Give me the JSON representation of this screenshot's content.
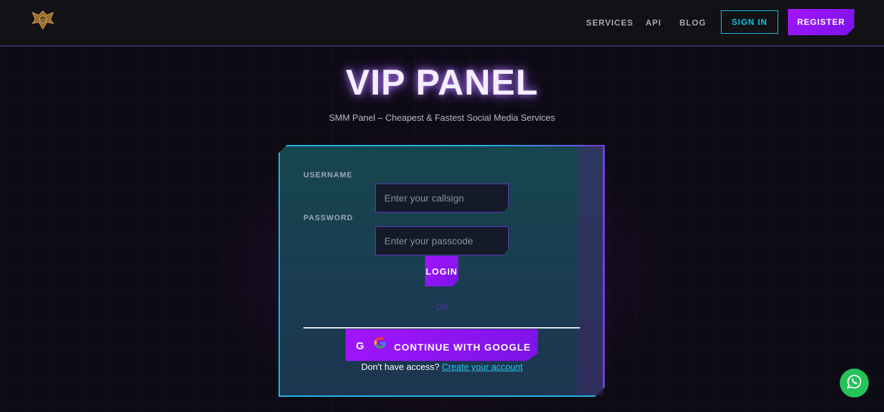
{
  "navbar": {
    "links": [
      "SERVICES",
      "API",
      "BLOG"
    ],
    "signin_label": "SIGN IN",
    "register_label": "REGISTER",
    "logo_icon": "eagle-vip-logo-icon"
  },
  "hero": {
    "title": "VIP PANEL",
    "subtitle": "SMM Panel – Cheapest & Fastest Social Media Services"
  },
  "login": {
    "username_label": "USERNAME",
    "username_placeholder": "Enter your callsign",
    "password_label": "PASSWORD",
    "password_placeholder": "Enter your passcode",
    "login_label": "LOGIN",
    "or_label": "OR",
    "google_prefix": "G",
    "google_label": "CONTINUE WITH GOOGLE",
    "signup_prompt": "Don't have access?",
    "signup_link": "Create your account"
  },
  "colors": {
    "accent_purple": "#a315ff",
    "accent_cyan": "#17c3e6",
    "whatsapp_green": "#25c35a"
  },
  "floating": {
    "whatsapp_icon": "whatsapp-icon"
  }
}
